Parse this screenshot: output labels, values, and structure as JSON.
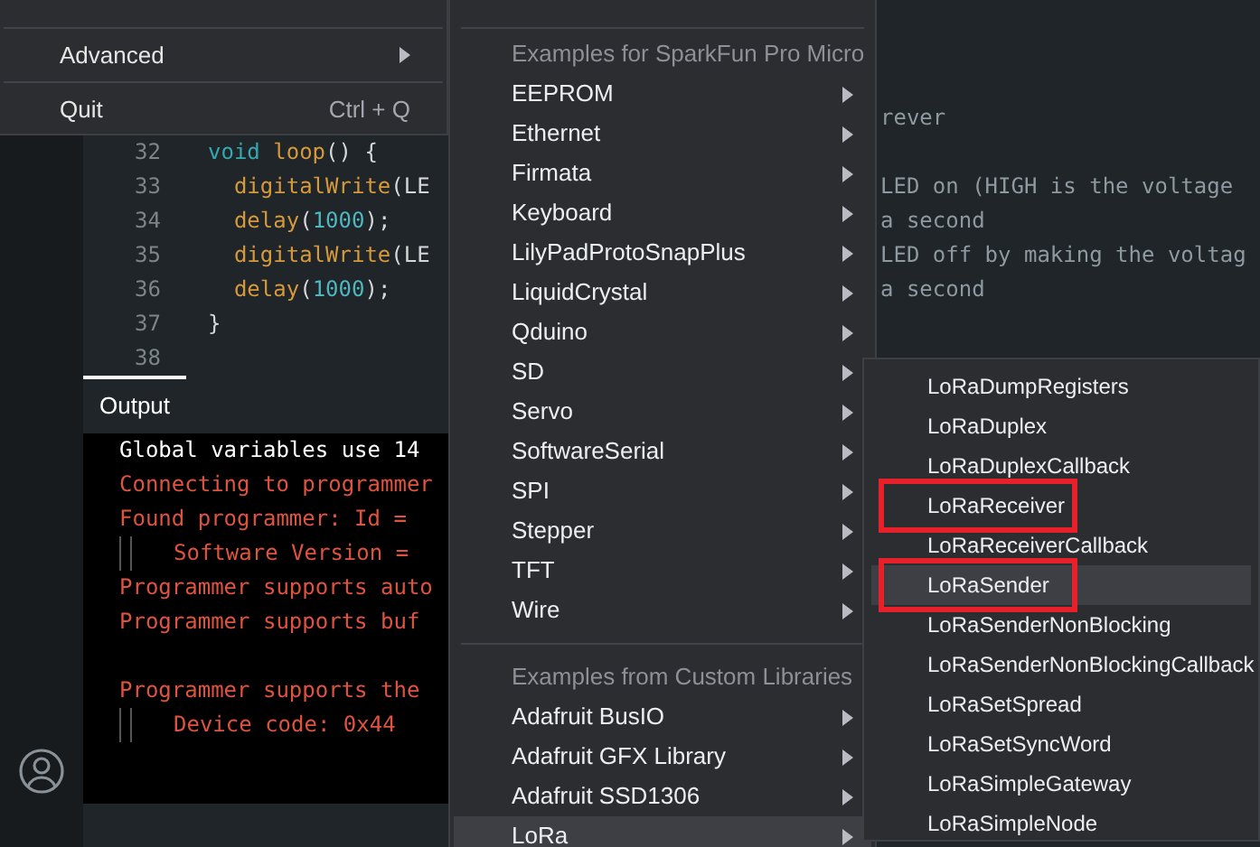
{
  "code_rows": [
    {
      "comment": "rever"
    },
    {
      "number": "32",
      "tokens": [
        {
          "text": "void ",
          "kind": "keyword"
        },
        {
          "text": "loop",
          "kind": "func"
        },
        {
          "text": "() {",
          "kind": "plain"
        }
      ]
    },
    {
      "number": "33",
      "tokens": [
        {
          "text": "  digitalWrite",
          "kind": "func"
        },
        {
          "text": "(LE",
          "kind": "plain"
        }
      ],
      "comment": "LED on (HIGH is the voltage"
    },
    {
      "number": "34",
      "tokens": [
        {
          "text": "  delay",
          "kind": "func"
        },
        {
          "text": "(",
          "kind": "plain"
        },
        {
          "text": "1000",
          "kind": "number"
        },
        {
          "text": ");",
          "kind": "plain"
        }
      ],
      "comment": "a second"
    },
    {
      "number": "35",
      "tokens": [
        {
          "text": "  digitalWrite",
          "kind": "func"
        },
        {
          "text": "(LE",
          "kind": "plain"
        }
      ],
      "comment": "LED off by making the voltag"
    },
    {
      "number": "36",
      "tokens": [
        {
          "text": "  delay",
          "kind": "func"
        },
        {
          "text": "(",
          "kind": "plain"
        },
        {
          "text": "1000",
          "kind": "number"
        },
        {
          "text": ");",
          "kind": "plain"
        }
      ],
      "comment": "a second"
    },
    {
      "number": "37",
      "tokens": [
        {
          "text": "}",
          "kind": "plain"
        }
      ]
    },
    {
      "number": "38",
      "tokens": []
    }
  ],
  "output": {
    "tab": "Output",
    "lines": [
      {
        "text": "Global variables use 14",
        "kind": "info",
        "indented": false
      },
      {
        "text": "Connecting to programmer",
        "kind": "error",
        "indented": false
      },
      {
        "text": "Found programmer: Id = ",
        "kind": "error",
        "indented": false
      },
      {
        "text": "Software Version = ",
        "kind": "error",
        "indented": true
      },
      {
        "text": "Programmer supports auto",
        "kind": "error",
        "indented": false
      },
      {
        "text": "Programmer supports buf",
        "kind": "error",
        "indented": false
      },
      {
        "kind": "blank"
      },
      {
        "text": "Programmer supports the",
        "kind": "error",
        "indented": false
      },
      {
        "text": "Device code: 0x44",
        "kind": "error",
        "indented": true
      }
    ]
  },
  "file_menu": [
    {
      "label": "Advanced",
      "submenu": true
    },
    {
      "label": "Quit",
      "shortcut": "Ctrl + Q",
      "submenu": false
    }
  ],
  "examples_menu": [
    {
      "kind": "separator"
    },
    {
      "kind": "header",
      "label": "Examples for SparkFun Pro Micro"
    },
    {
      "kind": "item",
      "label": "EEPROM",
      "selected": false
    },
    {
      "kind": "item",
      "label": "Ethernet",
      "selected": false
    },
    {
      "kind": "item",
      "label": "Firmata",
      "selected": false
    },
    {
      "kind": "item",
      "label": "Keyboard",
      "selected": false
    },
    {
      "kind": "item",
      "label": "LilyPadProtoSnapPlus",
      "selected": false
    },
    {
      "kind": "item",
      "label": "LiquidCrystal",
      "selected": false
    },
    {
      "kind": "item",
      "label": "Qduino",
      "selected": false
    },
    {
      "kind": "item",
      "label": "SD",
      "selected": false
    },
    {
      "kind": "item",
      "label": "Servo",
      "selected": false
    },
    {
      "kind": "item",
      "label": "SoftwareSerial",
      "selected": false
    },
    {
      "kind": "item",
      "label": "SPI",
      "selected": false
    },
    {
      "kind": "item",
      "label": "Stepper",
      "selected": false
    },
    {
      "kind": "item",
      "label": "TFT",
      "selected": false
    },
    {
      "kind": "item",
      "label": "Wire",
      "selected": false
    },
    {
      "kind": "separator"
    },
    {
      "kind": "header",
      "label": "Examples from Custom Libraries"
    },
    {
      "kind": "item",
      "label": "Adafruit BusIO",
      "selected": false
    },
    {
      "kind": "item",
      "label": "Adafruit GFX Library",
      "selected": false
    },
    {
      "kind": "item",
      "label": "Adafruit SSD1306",
      "selected": false
    },
    {
      "kind": "item",
      "label": "LoRa",
      "selected": true
    }
  ],
  "lora_menu": [
    {
      "label": "LoRaDumpRegisters",
      "selected": false,
      "annotated": false
    },
    {
      "label": "LoRaDuplex",
      "selected": false,
      "annotated": false
    },
    {
      "label": "LoRaDuplexCallback",
      "selected": false,
      "annotated": false
    },
    {
      "label": "LoRaReceiver",
      "selected": false,
      "annotated": true
    },
    {
      "label": "LoRaReceiverCallback",
      "selected": false,
      "annotated": false
    },
    {
      "label": "LoRaSender",
      "selected": true,
      "annotated": true
    },
    {
      "label": "LoRaSenderNonBlocking",
      "selected": false,
      "annotated": false
    },
    {
      "label": "LoRaSenderNonBlockingCallback",
      "selected": false,
      "annotated": false
    },
    {
      "label": "LoRaSetSpread",
      "selected": false,
      "annotated": false
    },
    {
      "label": "LoRaSetSyncWord",
      "selected": false,
      "annotated": false
    },
    {
      "label": "LoRaSimpleGateway",
      "selected": false,
      "annotated": false
    },
    {
      "label": "LoRaSimpleNode",
      "selected": false,
      "annotated": false
    }
  ]
}
